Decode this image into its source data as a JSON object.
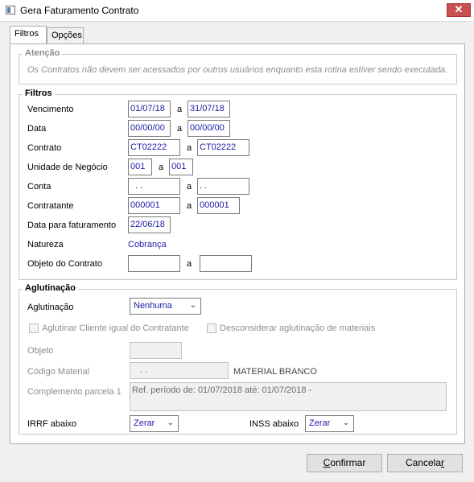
{
  "window": {
    "title": "Gera Faturamento Contrato",
    "close_label": "✕"
  },
  "tabs": [
    {
      "label": "Filtros"
    },
    {
      "label": "Opções"
    }
  ],
  "attention": {
    "title": "Atenção",
    "message": "Os Contratos não devem ser acessados por outros usuários enquanto esta rotina estiver sendo executada."
  },
  "filters": {
    "title": "Filtros",
    "sep": "a",
    "vencimento": {
      "label": "Vencimento",
      "from": "01/07/18",
      "to": "31/07/18"
    },
    "data": {
      "label": "Data",
      "from": "00/00/00",
      "to": "00/00/00"
    },
    "contrato": {
      "label": "Contrato",
      "from": "CT02222",
      "to": "CT02222"
    },
    "unidade": {
      "label": "Unidade de Negócio",
      "from": "001",
      "to": "001"
    },
    "conta": {
      "label": "Conta",
      "from": ". .",
      "to": ". ."
    },
    "contratante": {
      "label": "Contratante",
      "from": "000001",
      "to": "000001"
    },
    "data_faturamento": {
      "label": "Data para faturamento",
      "value": "22/06/18"
    },
    "natureza": {
      "label": "Natureza",
      "value": "Cobrança"
    },
    "objeto": {
      "label": "Objeto do Contrato",
      "from": "",
      "to": ""
    }
  },
  "aglutinacao": {
    "title": "Aglutinação",
    "label": "Aglutinação",
    "selected": "Nenhuma",
    "chk_cliente": "Aglutinar Cliente igual do Contratante",
    "chk_materiais": "Desconsiderar aglutinação de materiais",
    "objeto_label": "Objeto",
    "objeto_value": "",
    "codigo_label": "Código Material",
    "codigo_value": ". .",
    "material_name": "MATERIAL BRANCO",
    "complemento_label": "Complemento parcela 1",
    "complemento_value": "Ref. período de: 01/07/2018 até: 01/07/2018 -",
    "irrf_label": "IRRF abaixo",
    "irrf_value": "Zerar",
    "inss_label": "INSS abaixo",
    "inss_value": "Zerar"
  },
  "buttons": {
    "confirm_first": "C",
    "confirm_rest": "onfirmar",
    "cancel_first": "Cancela",
    "cancel_rest": "r"
  }
}
